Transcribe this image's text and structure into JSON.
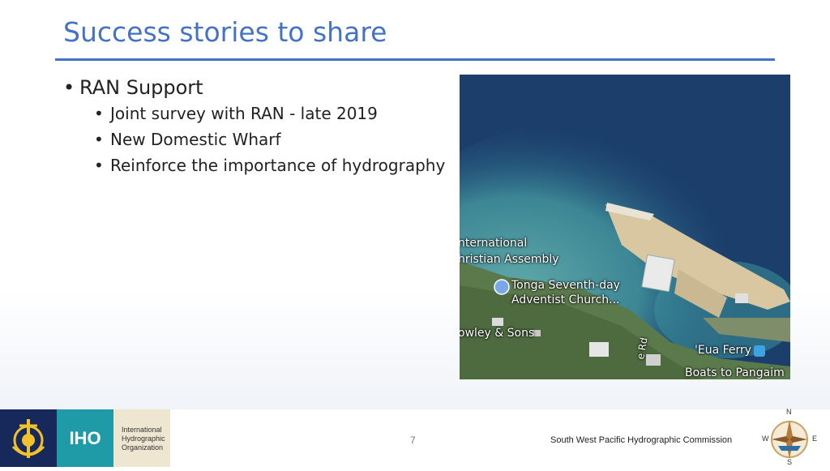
{
  "slide": {
    "title": "Success stories to share",
    "bullet_level1": "RAN Support",
    "bullets_level2": [
      "Joint survey with RAN - late 2019",
      "New Domestic Wharf",
      "Reinforce the importance of hydrography"
    ],
    "bullet_glyph": "•"
  },
  "map": {
    "labels": [
      "nternational",
      "hristian Assembly",
      "Tonga Seventh-day",
      "Adventist Church...",
      "owley & Sons",
      "'Eua Ferry",
      "Boats to Pangaim",
      "e Rd"
    ]
  },
  "footer": {
    "iho_abbrev": "IHO",
    "iho_name_lines": [
      "International",
      "Hydrographic",
      "Organization"
    ],
    "page_number": "7",
    "commission": "South West Pacific Hydrographic Commission",
    "compass_letters": [
      "N",
      "W",
      "E",
      "S"
    ]
  },
  "colors": {
    "title": "#4472c4",
    "navy": "#17285a",
    "teal": "#1e9ba6",
    "beige": "#efe6d2"
  }
}
